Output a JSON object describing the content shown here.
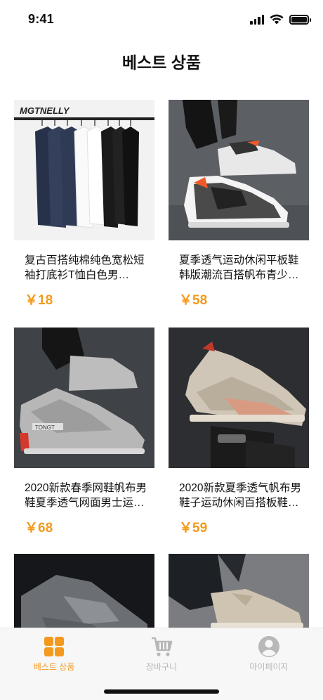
{
  "status_bar": {
    "time": "9:41"
  },
  "header": {
    "title": "베스트 상품"
  },
  "products": [
    {
      "name": "复古百搭纯棉纯色宽松短袖打底衫T恤白色男…",
      "price": "￥18",
      "image_icon": "tshirt-rack-image"
    },
    {
      "name": "夏季透气运动休闲平板鞋韩版潮流百搭帆布青少年…",
      "price": "￥58",
      "image_icon": "sneaker-image"
    },
    {
      "name": "2020新款春季网鞋帆布男鞋夏季透气网面男士运…",
      "price": "￥68",
      "image_icon": "sneaker-image"
    },
    {
      "name": "2020新款夏季透气帆布男鞋子运动休闲百搭板鞋…",
      "price": "￥59",
      "image_icon": "sneaker-image"
    },
    {
      "name": "",
      "price": "",
      "image_icon": "sneaker-image"
    },
    {
      "name": "",
      "price": "",
      "image_icon": "shoe-image"
    }
  ],
  "tab_bar": {
    "tabs": [
      {
        "label": "베스트 상품",
        "icon": "grid-icon",
        "active": true
      },
      {
        "label": "장바구니",
        "icon": "cart-icon",
        "active": false
      },
      {
        "label": "마이페이지",
        "icon": "user-icon",
        "active": false
      }
    ]
  },
  "colors": {
    "accent": "#f39a1e",
    "inactive": "#b8b8b8"
  }
}
